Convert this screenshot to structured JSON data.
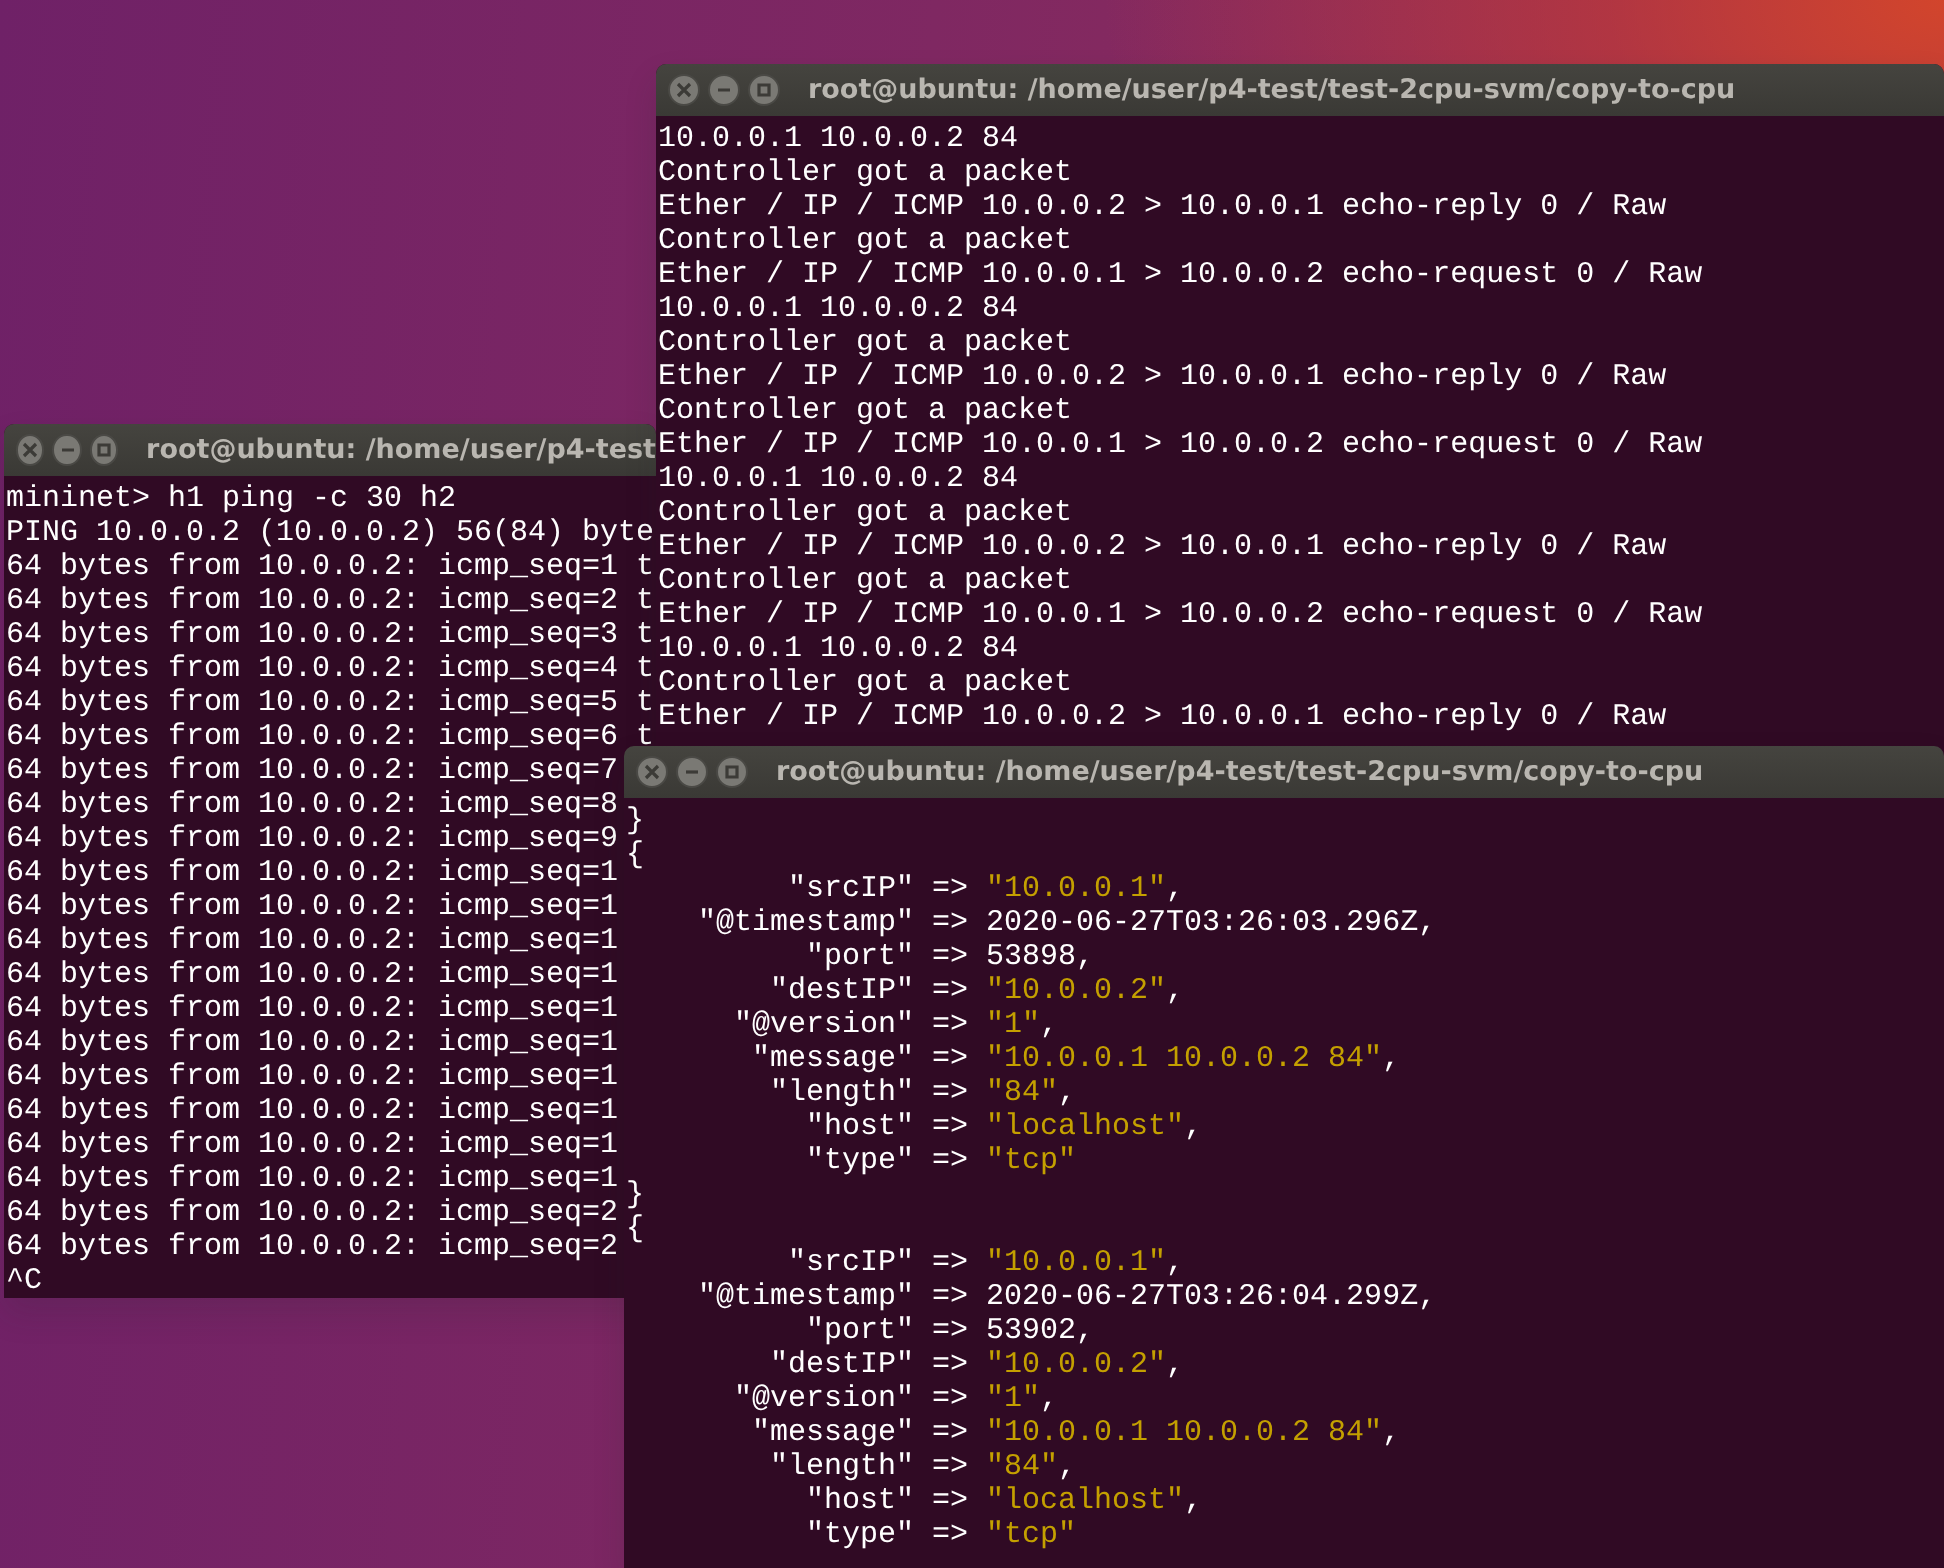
{
  "windows": [
    {
      "title": "root@ubuntu: /home/user/p4-test",
      "kind": "plain",
      "lines": [
        "mininet> h1 ping -c 30 h2",
        "PING 10.0.0.2 (10.0.0.2) 56(84) byte",
        "64 bytes from 10.0.0.2: icmp_seq=1 t",
        "64 bytes from 10.0.0.2: icmp_seq=2 t",
        "64 bytes from 10.0.0.2: icmp_seq=3 t",
        "64 bytes from 10.0.0.2: icmp_seq=4 t",
        "64 bytes from 10.0.0.2: icmp_seq=5 t",
        "64 bytes from 10.0.0.2: icmp_seq=6 t",
        "64 bytes from 10.0.0.2: icmp_seq=7",
        "64 bytes from 10.0.0.2: icmp_seq=8",
        "64 bytes from 10.0.0.2: icmp_seq=9",
        "64 bytes from 10.0.0.2: icmp_seq=1",
        "64 bytes from 10.0.0.2: icmp_seq=1",
        "64 bytes from 10.0.0.2: icmp_seq=1",
        "64 bytes from 10.0.0.2: icmp_seq=1",
        "64 bytes from 10.0.0.2: icmp_seq=1",
        "64 bytes from 10.0.0.2: icmp_seq=1",
        "64 bytes from 10.0.0.2: icmp_seq=1",
        "64 bytes from 10.0.0.2: icmp_seq=1",
        "64 bytes from 10.0.0.2: icmp_seq=1",
        "64 bytes from 10.0.0.2: icmp_seq=1",
        "64 bytes from 10.0.0.2: icmp_seq=2",
        "64 bytes from 10.0.0.2: icmp_seq=2",
        "^C"
      ]
    },
    {
      "title": "root@ubuntu: /home/user/p4-test/test-2cpu-svm/copy-to-cpu",
      "kind": "plain",
      "lines": [
        "10.0.0.1 10.0.0.2 84",
        "Controller got a packet",
        "Ether / IP / ICMP 10.0.0.2 > 10.0.0.1 echo-reply 0 / Raw",
        "Controller got a packet",
        "Ether / IP / ICMP 10.0.0.1 > 10.0.0.2 echo-request 0 / Raw",
        "10.0.0.1 10.0.0.2 84",
        "Controller got a packet",
        "Ether / IP / ICMP 10.0.0.2 > 10.0.0.1 echo-reply 0 / Raw",
        "Controller got a packet",
        "Ether / IP / ICMP 10.0.0.1 > 10.0.0.2 echo-request 0 / Raw",
        "10.0.0.1 10.0.0.2 84",
        "Controller got a packet",
        "Ether / IP / ICMP 10.0.0.2 > 10.0.0.1 echo-reply 0 / Raw",
        "Controller got a packet",
        "Ether / IP / ICMP 10.0.0.1 > 10.0.0.2 echo-request 0 / Raw",
        "10.0.0.1 10.0.0.2 84",
        "Controller got a packet",
        "Ether / IP / ICMP 10.0.0.2 > 10.0.0.1 echo-reply 0 / Raw"
      ]
    },
    {
      "title": "root@ubuntu: /home/user/p4-test/test-2cpu-svm/copy-to-cpu",
      "kind": "hash",
      "lines": [
        {
          "kind": "brace",
          "text": "}"
        },
        {
          "kind": "brace",
          "text": "{"
        },
        {
          "kind": "quoted",
          "key": "\"srcIP\"",
          "arrow": "=>",
          "value": "\"10.0.0.1\"",
          "trail": ","
        },
        {
          "kind": "bare",
          "key": "\"@timestamp\"",
          "arrow": "=>",
          "value": "2020-06-27T03:26:03.296Z",
          "trail": ","
        },
        {
          "kind": "bare",
          "key": "\"port\"",
          "arrow": "=>",
          "value": "53898",
          "trail": ","
        },
        {
          "kind": "quoted",
          "key": "\"destIP\"",
          "arrow": "=>",
          "value": "\"10.0.0.2\"",
          "trail": ","
        },
        {
          "kind": "quoted",
          "key": "\"@version\"",
          "arrow": "=>",
          "value": "\"1\"",
          "trail": ","
        },
        {
          "kind": "quoted",
          "key": "\"message\"",
          "arrow": "=>",
          "value": "\"10.0.0.1 10.0.0.2 84\"",
          "trail": ","
        },
        {
          "kind": "quoted",
          "key": "\"length\"",
          "arrow": "=>",
          "value": "\"84\"",
          "trail": ","
        },
        {
          "kind": "quoted",
          "key": "\"host\"",
          "arrow": "=>",
          "value": "\"localhost\"",
          "trail": ","
        },
        {
          "kind": "quoted",
          "key": "\"type\"",
          "arrow": "=>",
          "value": "\"tcp\""
        },
        {
          "kind": "brace",
          "text": "}"
        },
        {
          "kind": "brace",
          "text": "{"
        },
        {
          "kind": "quoted",
          "key": "\"srcIP\"",
          "arrow": "=>",
          "value": "\"10.0.0.1\"",
          "trail": ","
        },
        {
          "kind": "bare",
          "key": "\"@timestamp\"",
          "arrow": "=>",
          "value": "2020-06-27T03:26:04.299Z",
          "trail": ","
        },
        {
          "kind": "bare",
          "key": "\"port\"",
          "arrow": "=>",
          "value": "53902",
          "trail": ","
        },
        {
          "kind": "quoted",
          "key": "\"destIP\"",
          "arrow": "=>",
          "value": "\"10.0.0.2\"",
          "trail": ","
        },
        {
          "kind": "quoted",
          "key": "\"@version\"",
          "arrow": "=>",
          "value": "\"1\"",
          "trail": ","
        },
        {
          "kind": "quoted",
          "key": "\"message\"",
          "arrow": "=>",
          "value": "\"10.0.0.1 10.0.0.2 84\"",
          "trail": ","
        },
        {
          "kind": "quoted",
          "key": "\"length\"",
          "arrow": "=>",
          "value": "\"84\"",
          "trail": ","
        },
        {
          "kind": "quoted",
          "key": "\"host\"",
          "arrow": "=>",
          "value": "\"localhost\"",
          "trail": ","
        },
        {
          "kind": "quoted",
          "key": "\"type\"",
          "arrow": "=>",
          "value": "\"tcp\""
        }
      ]
    }
  ]
}
